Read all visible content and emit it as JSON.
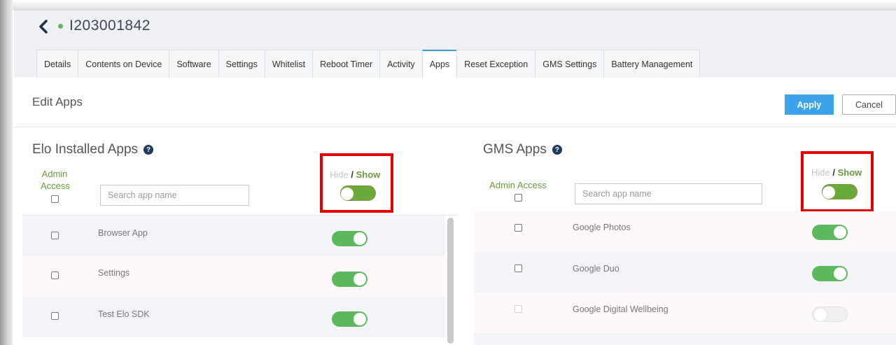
{
  "header": {
    "device_id": "I203001842",
    "tabs": [
      "Details",
      "Contents on Device",
      "Software",
      "Settings",
      "Whitelist",
      "Reboot Timer",
      "Activity",
      "Apps",
      "Reset Exception",
      "GMS Settings",
      "Battery Management"
    ],
    "active_tab": "Apps"
  },
  "edit": {
    "title": "Edit Apps",
    "apply_label": "Apply",
    "cancel_label": "Cancel"
  },
  "elo_panel": {
    "title": "Elo Installed Apps",
    "admin_label_line1": "Admin",
    "admin_label_line2": "Access",
    "search_placeholder": "Search app name",
    "hide_label": "Hide",
    "slash": "/",
    "show_label": "Show",
    "apps": [
      {
        "name": "Browser App",
        "shown": true
      },
      {
        "name": "Settings",
        "shown": true
      },
      {
        "name": "Test Elo SDK",
        "shown": true
      }
    ]
  },
  "gms_panel": {
    "title": "GMS Apps",
    "admin_label": "Admin Access",
    "search_placeholder": "Search app name",
    "hide_label": "Hide",
    "slash": "/",
    "show_label": "Show",
    "apps": [
      {
        "name": "Google Photos",
        "shown": true
      },
      {
        "name": "Google Duo",
        "shown": true
      },
      {
        "name": "Google Digital Wellbeing",
        "shown": false
      }
    ]
  },
  "colors": {
    "accent": "#3ba3ea",
    "toggle_on": "#5cb85c",
    "show_green": "#6a9a3c",
    "highlight_red": "#e60000"
  },
  "icons": [
    "chevron-left-icon",
    "status-dot-icon",
    "help-icon"
  ]
}
